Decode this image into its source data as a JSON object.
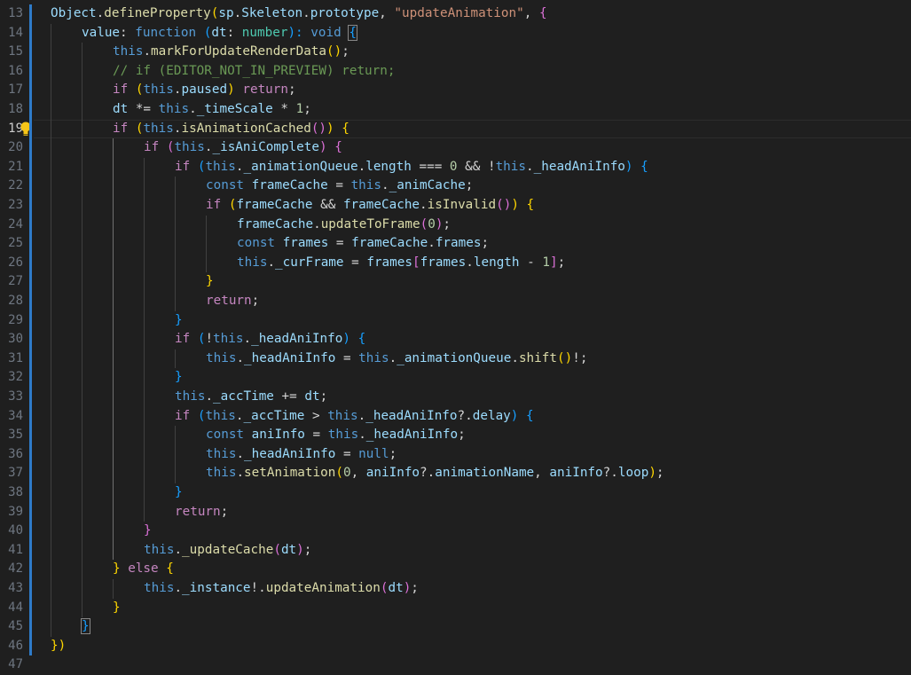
{
  "colors": {
    "background": "#1f1f1f",
    "line_number": "#6e7681",
    "line_number_active": "#cccccc",
    "git_modified": "#2e7bc9",
    "plain": "#d4d4d4",
    "variable": "#9cdcfe",
    "function": "#dcdcaa",
    "keyword": "#569cd6",
    "control": "#c586c0",
    "string": "#ce9178",
    "number": "#b5cea8",
    "comment": "#6a9955",
    "type": "#4ec9b0",
    "bracket_1": "#ffd700",
    "bracket_2": "#da70d6",
    "bracket_3": "#179fff"
  },
  "editor": {
    "active_line": 19,
    "lightbulb_icon": "lightbulb-icon",
    "lines": [
      {
        "n": 13,
        "indent": 0,
        "tokens": [
          [
            "Object",
            "var"
          ],
          [
            ".",
            "plain"
          ],
          [
            "defineProperty",
            "fn"
          ],
          [
            "(",
            "br1"
          ],
          [
            "sp",
            "var"
          ],
          [
            ".",
            "plain"
          ],
          [
            "Skeleton",
            "var"
          ],
          [
            ".",
            "plain"
          ],
          [
            "prototype",
            "var"
          ],
          [
            ", ",
            "plain"
          ],
          [
            "\"updateAnimation\"",
            "str"
          ],
          [
            ", ",
            "plain"
          ],
          [
            "{",
            "br2"
          ]
        ]
      },
      {
        "n": 14,
        "indent": 1,
        "tokens": [
          [
            "value",
            "var"
          ],
          [
            ": ",
            "plain"
          ],
          [
            "function",
            "kw"
          ],
          [
            " ",
            "plain"
          ],
          [
            "(",
            "br3"
          ],
          [
            "dt",
            "var"
          ],
          [
            ": ",
            "plain"
          ],
          [
            "number",
            "cls"
          ],
          [
            "): ",
            "br3"
          ],
          [
            "void",
            "kw"
          ],
          [
            " ",
            "plain"
          ],
          [
            "{",
            "brbox"
          ]
        ]
      },
      {
        "n": 15,
        "indent": 2,
        "tokens": [
          [
            "this",
            "kw"
          ],
          [
            ".",
            "plain"
          ],
          [
            "markForUpdateRenderData",
            "fn"
          ],
          [
            "()",
            "br1"
          ],
          [
            ";",
            "plain"
          ]
        ]
      },
      {
        "n": 16,
        "indent": 2,
        "tokens": [
          [
            "// if (EDITOR_NOT_IN_PREVIEW) return;",
            "cmt"
          ]
        ]
      },
      {
        "n": 17,
        "indent": 2,
        "tokens": [
          [
            "if",
            "ctl"
          ],
          [
            " ",
            "plain"
          ],
          [
            "(",
            "br1"
          ],
          [
            "this",
            "kw"
          ],
          [
            ".",
            "plain"
          ],
          [
            "paused",
            "var"
          ],
          [
            ")",
            "br1"
          ],
          [
            " ",
            "plain"
          ],
          [
            "return",
            "ctl"
          ],
          [
            ";",
            "plain"
          ]
        ]
      },
      {
        "n": 18,
        "indent": 2,
        "tokens": [
          [
            "dt",
            "var"
          ],
          [
            " *= ",
            "plain"
          ],
          [
            "this",
            "kw"
          ],
          [
            ".",
            "plain"
          ],
          [
            "_timeScale",
            "var"
          ],
          [
            " * ",
            "plain"
          ],
          [
            "1",
            "num"
          ],
          [
            ";",
            "plain"
          ]
        ]
      },
      {
        "n": 19,
        "indent": 2,
        "tokens": [
          [
            "if",
            "ctl"
          ],
          [
            " ",
            "plain"
          ],
          [
            "(",
            "br1"
          ],
          [
            "this",
            "kw"
          ],
          [
            ".",
            "plain"
          ],
          [
            "isAnimationCached",
            "fn"
          ],
          [
            "()",
            "br2"
          ],
          [
            ")",
            "br1"
          ],
          [
            " ",
            "plain"
          ],
          [
            "{",
            "br1"
          ]
        ]
      },
      {
        "n": 20,
        "indent": 3,
        "tokens": [
          [
            "if",
            "ctl"
          ],
          [
            " ",
            "plain"
          ],
          [
            "(",
            "br2"
          ],
          [
            "this",
            "kw"
          ],
          [
            ".",
            "plain"
          ],
          [
            "_isAniComplete",
            "var"
          ],
          [
            ")",
            "br2"
          ],
          [
            " ",
            "plain"
          ],
          [
            "{",
            "br2"
          ]
        ]
      },
      {
        "n": 21,
        "indent": 4,
        "tokens": [
          [
            "if",
            "ctl"
          ],
          [
            " ",
            "plain"
          ],
          [
            "(",
            "br3"
          ],
          [
            "this",
            "kw"
          ],
          [
            ".",
            "plain"
          ],
          [
            "_animationQueue",
            "var"
          ],
          [
            ".",
            "plain"
          ],
          [
            "length",
            "var"
          ],
          [
            " === ",
            "plain"
          ],
          [
            "0",
            "num"
          ],
          [
            " && !",
            "plain"
          ],
          [
            "this",
            "kw"
          ],
          [
            ".",
            "plain"
          ],
          [
            "_headAniInfo",
            "var"
          ],
          [
            ")",
            "br3"
          ],
          [
            " ",
            "plain"
          ],
          [
            "{",
            "br3"
          ]
        ]
      },
      {
        "n": 22,
        "indent": 5,
        "tokens": [
          [
            "const",
            "kw"
          ],
          [
            " ",
            "plain"
          ],
          [
            "frameCache",
            "var"
          ],
          [
            " = ",
            "plain"
          ],
          [
            "this",
            "kw"
          ],
          [
            ".",
            "plain"
          ],
          [
            "_animCache",
            "var"
          ],
          [
            ";",
            "plain"
          ]
        ]
      },
      {
        "n": 23,
        "indent": 5,
        "tokens": [
          [
            "if",
            "ctl"
          ],
          [
            " ",
            "plain"
          ],
          [
            "(",
            "br1"
          ],
          [
            "frameCache",
            "var"
          ],
          [
            " && ",
            "plain"
          ],
          [
            "frameCache",
            "var"
          ],
          [
            ".",
            "plain"
          ],
          [
            "isInvalid",
            "fn"
          ],
          [
            "()",
            "br2"
          ],
          [
            ")",
            "br1"
          ],
          [
            " ",
            "plain"
          ],
          [
            "{",
            "br1"
          ]
        ]
      },
      {
        "n": 24,
        "indent": 6,
        "tokens": [
          [
            "frameCache",
            "var"
          ],
          [
            ".",
            "plain"
          ],
          [
            "updateToFrame",
            "fn"
          ],
          [
            "(",
            "br2"
          ],
          [
            "0",
            "num"
          ],
          [
            ")",
            "br2"
          ],
          [
            ";",
            "plain"
          ]
        ]
      },
      {
        "n": 25,
        "indent": 6,
        "tokens": [
          [
            "const",
            "kw"
          ],
          [
            " ",
            "plain"
          ],
          [
            "frames",
            "var"
          ],
          [
            " = ",
            "plain"
          ],
          [
            "frameCache",
            "var"
          ],
          [
            ".",
            "plain"
          ],
          [
            "frames",
            "var"
          ],
          [
            ";",
            "plain"
          ]
        ]
      },
      {
        "n": 26,
        "indent": 6,
        "tokens": [
          [
            "this",
            "kw"
          ],
          [
            ".",
            "plain"
          ],
          [
            "_curFrame",
            "var"
          ],
          [
            " = ",
            "plain"
          ],
          [
            "frames",
            "var"
          ],
          [
            "[",
            "br2"
          ],
          [
            "frames",
            "var"
          ],
          [
            ".",
            "plain"
          ],
          [
            "length",
            "var"
          ],
          [
            " - ",
            "plain"
          ],
          [
            "1",
            "num"
          ],
          [
            "]",
            "br2"
          ],
          [
            ";",
            "plain"
          ]
        ]
      },
      {
        "n": 27,
        "indent": 5,
        "tokens": [
          [
            "}",
            "br1"
          ]
        ]
      },
      {
        "n": 28,
        "indent": 5,
        "tokens": [
          [
            "return",
            "ctl"
          ],
          [
            ";",
            "plain"
          ]
        ]
      },
      {
        "n": 29,
        "indent": 4,
        "tokens": [
          [
            "}",
            "br3"
          ]
        ]
      },
      {
        "n": 30,
        "indent": 4,
        "tokens": [
          [
            "if",
            "ctl"
          ],
          [
            " ",
            "plain"
          ],
          [
            "(",
            "br3"
          ],
          [
            "!",
            "plain"
          ],
          [
            "this",
            "kw"
          ],
          [
            ".",
            "plain"
          ],
          [
            "_headAniInfo",
            "var"
          ],
          [
            ")",
            "br3"
          ],
          [
            " ",
            "plain"
          ],
          [
            "{",
            "br3"
          ]
        ]
      },
      {
        "n": 31,
        "indent": 5,
        "tokens": [
          [
            "this",
            "kw"
          ],
          [
            ".",
            "plain"
          ],
          [
            "_headAniInfo",
            "var"
          ],
          [
            " = ",
            "plain"
          ],
          [
            "this",
            "kw"
          ],
          [
            ".",
            "plain"
          ],
          [
            "_animationQueue",
            "var"
          ],
          [
            ".",
            "plain"
          ],
          [
            "shift",
            "fn"
          ],
          [
            "()",
            "br1"
          ],
          [
            "!;",
            "plain"
          ]
        ]
      },
      {
        "n": 32,
        "indent": 4,
        "tokens": [
          [
            "}",
            "br3"
          ]
        ]
      },
      {
        "n": 33,
        "indent": 4,
        "tokens": [
          [
            "this",
            "kw"
          ],
          [
            ".",
            "plain"
          ],
          [
            "_accTime",
            "var"
          ],
          [
            " += ",
            "plain"
          ],
          [
            "dt",
            "var"
          ],
          [
            ";",
            "plain"
          ]
        ]
      },
      {
        "n": 34,
        "indent": 4,
        "tokens": [
          [
            "if",
            "ctl"
          ],
          [
            " ",
            "plain"
          ],
          [
            "(",
            "br3"
          ],
          [
            "this",
            "kw"
          ],
          [
            ".",
            "plain"
          ],
          [
            "_accTime",
            "var"
          ],
          [
            " > ",
            "plain"
          ],
          [
            "this",
            "kw"
          ],
          [
            ".",
            "plain"
          ],
          [
            "_headAniInfo",
            "var"
          ],
          [
            "?.",
            "plain"
          ],
          [
            "delay",
            "var"
          ],
          [
            ")",
            "br3"
          ],
          [
            " ",
            "plain"
          ],
          [
            "{",
            "br3"
          ]
        ]
      },
      {
        "n": 35,
        "indent": 5,
        "tokens": [
          [
            "const",
            "kw"
          ],
          [
            " ",
            "plain"
          ],
          [
            "aniInfo",
            "var"
          ],
          [
            " = ",
            "plain"
          ],
          [
            "this",
            "kw"
          ],
          [
            ".",
            "plain"
          ],
          [
            "_headAniInfo",
            "var"
          ],
          [
            ";",
            "plain"
          ]
        ]
      },
      {
        "n": 36,
        "indent": 5,
        "tokens": [
          [
            "this",
            "kw"
          ],
          [
            ".",
            "plain"
          ],
          [
            "_headAniInfo",
            "var"
          ],
          [
            " = ",
            "plain"
          ],
          [
            "null",
            "kw"
          ],
          [
            ";",
            "plain"
          ]
        ]
      },
      {
        "n": 37,
        "indent": 5,
        "tokens": [
          [
            "this",
            "kw"
          ],
          [
            ".",
            "plain"
          ],
          [
            "setAnimation",
            "fn"
          ],
          [
            "(",
            "br1"
          ],
          [
            "0",
            "num"
          ],
          [
            ", ",
            "plain"
          ],
          [
            "aniInfo",
            "var"
          ],
          [
            "?.",
            "plain"
          ],
          [
            "animationName",
            "var"
          ],
          [
            ", ",
            "plain"
          ],
          [
            "aniInfo",
            "var"
          ],
          [
            "?.",
            "plain"
          ],
          [
            "loop",
            "var"
          ],
          [
            ")",
            "br1"
          ],
          [
            ";",
            "plain"
          ]
        ]
      },
      {
        "n": 38,
        "indent": 4,
        "tokens": [
          [
            "}",
            "br3"
          ]
        ]
      },
      {
        "n": 39,
        "indent": 4,
        "tokens": [
          [
            "return",
            "ctl"
          ],
          [
            ";",
            "plain"
          ]
        ]
      },
      {
        "n": 40,
        "indent": 3,
        "tokens": [
          [
            "}",
            "br2"
          ]
        ]
      },
      {
        "n": 41,
        "indent": 3,
        "tokens": [
          [
            "this",
            "kw"
          ],
          [
            ".",
            "plain"
          ],
          [
            "_updateCache",
            "fn"
          ],
          [
            "(",
            "br2"
          ],
          [
            "dt",
            "var"
          ],
          [
            ")",
            "br2"
          ],
          [
            ";",
            "plain"
          ]
        ]
      },
      {
        "n": 42,
        "indent": 2,
        "tokens": [
          [
            "}",
            "br1"
          ],
          [
            " ",
            "plain"
          ],
          [
            "else",
            "ctl"
          ],
          [
            " ",
            "plain"
          ],
          [
            "{",
            "br1"
          ]
        ]
      },
      {
        "n": 43,
        "indent": 3,
        "tokens": [
          [
            "this",
            "kw"
          ],
          [
            ".",
            "plain"
          ],
          [
            "_instance",
            "var"
          ],
          [
            "!.",
            "plain"
          ],
          [
            "updateAnimation",
            "fn"
          ],
          [
            "(",
            "br2"
          ],
          [
            "dt",
            "var"
          ],
          [
            ")",
            "br2"
          ],
          [
            ";",
            "plain"
          ]
        ]
      },
      {
        "n": 44,
        "indent": 2,
        "tokens": [
          [
            "}",
            "br1"
          ]
        ]
      },
      {
        "n": 45,
        "indent": 1,
        "tokens": [
          [
            "}",
            "brbox"
          ]
        ]
      },
      {
        "n": 46,
        "indent": 0,
        "tokens": [
          [
            "})",
            "br1"
          ]
        ]
      },
      {
        "n": 47,
        "indent": 0,
        "tokens": []
      }
    ]
  }
}
